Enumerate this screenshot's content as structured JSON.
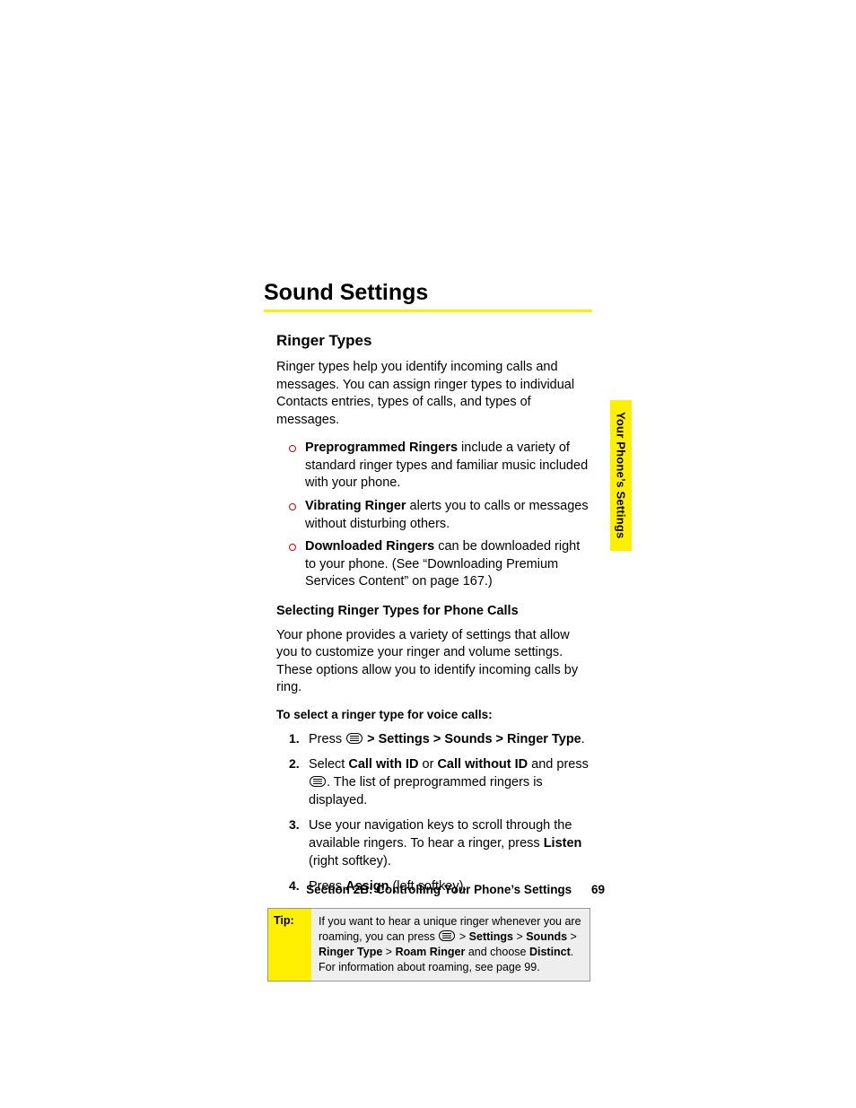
{
  "heading": "Sound Settings",
  "subheading": "Ringer Types",
  "intro": "Ringer types help you identify incoming calls and messages. You can assign ringer types to individual Contacts entries, types of calls, and types of messages.",
  "bullets": [
    {
      "term": "Preprogrammed Ringers",
      "rest": " include a variety of standard ringer types and familiar music included with your phone."
    },
    {
      "term": "Vibrating Ringer",
      "rest": " alerts you to calls or messages without disturbing others."
    },
    {
      "term": "Downloaded Ringers",
      "rest": " can be downloaded right to your phone. (See “Downloading Premium Services Content” on page 167.)"
    }
  ],
  "subsub": "Selecting Ringer Types for Phone Calls",
  "para2": "Your phone provides a variety of settings that allow you to customize your ringer and volume settings. These options allow you to identify incoming calls by ring.",
  "leadline": "To select a ringer type for voice calls:",
  "steps": {
    "s1": {
      "num": "1.",
      "pre": "Press ",
      "path": " > Settings > Sounds > Ringer Type",
      "post": "."
    },
    "s2": {
      "num": "2.",
      "a": "Select ",
      "b1": "Call with ID",
      "mid": " or ",
      "b2": "Call without ID",
      "c": " and press ",
      "d": ". The list of preprogrammed ringers is displayed."
    },
    "s3": {
      "num": "3.",
      "a": "Use your navigation keys to scroll through the available ringers. To hear a ringer, press ",
      "b": "Listen",
      "c": " (right softkey)."
    },
    "s4": {
      "num": "4.",
      "a": "Press ",
      "b": "Assign",
      "c": " (left softkey)."
    }
  },
  "tip": {
    "label": "Tip:",
    "a": "If you want to hear a unique ringer whenever you are roaming, you can press ",
    "p1": "Settings",
    "p2": "Sounds",
    "p3": "Ringer Type",
    "p4": "Roam Ringer",
    "mid": " and choose ",
    "distinct": "Distinct",
    "end": ". For information about roaming, see page 99."
  },
  "sidetab": "Your Phone’s Settings",
  "footer": {
    "section": "Section 2B: Controlling Your Phone’s Settings",
    "page": "69"
  }
}
